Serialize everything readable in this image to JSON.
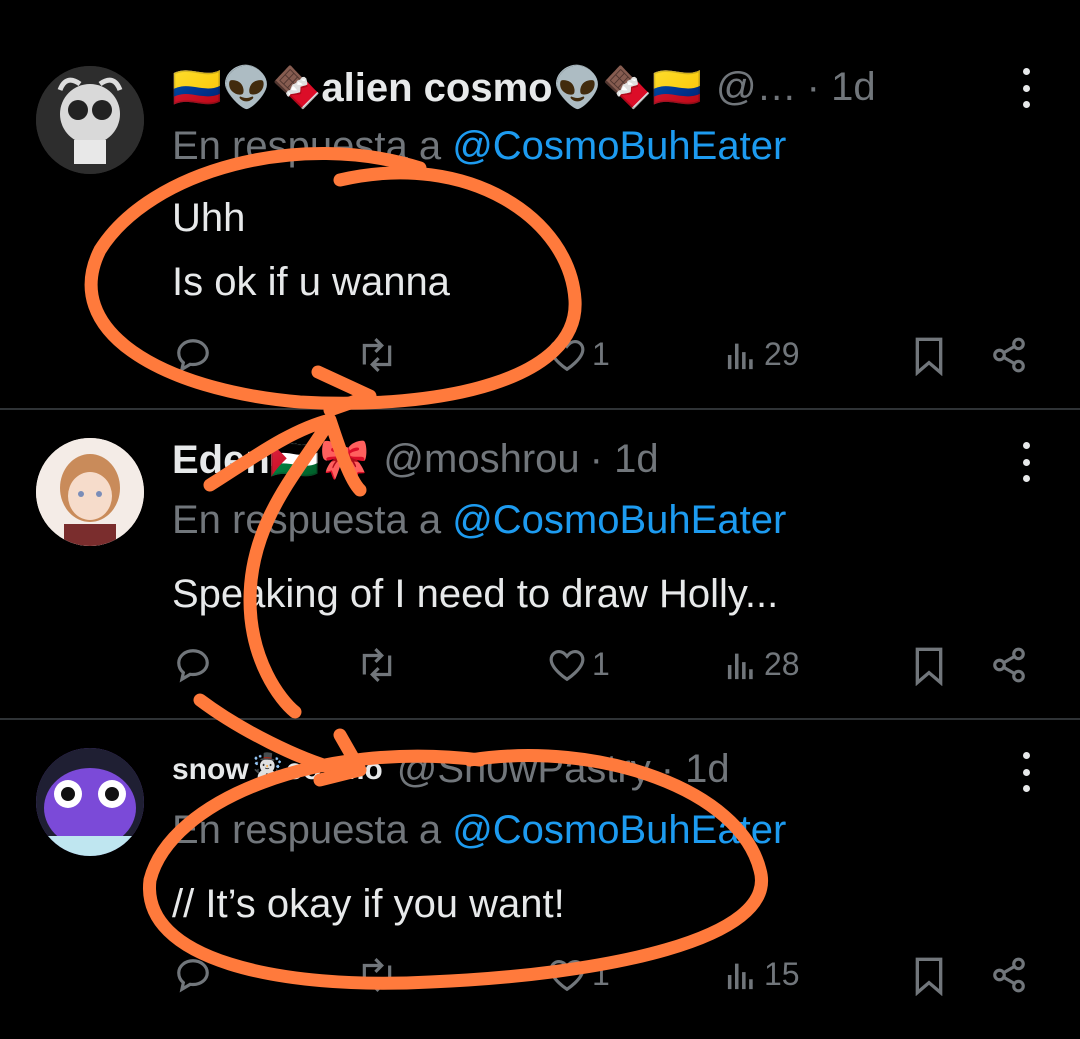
{
  "tweets": [
    {
      "name": "🇨🇴👽🍫alien cosmo👽🍫🇨🇴",
      "handle": "@…",
      "time": "· 1d",
      "reply_prefix": "En respuesta a",
      "reply_mention": "@CosmoBuhEater",
      "text": "Uhh\nIs ok if u wanna",
      "likes": "1",
      "views": "29",
      "avatar_color": "#3a3a3a"
    },
    {
      "name": "Eden🇵🇸🎀",
      "handle": "@moshrou",
      "time": "· 1d",
      "reply_prefix": "En respuesta a",
      "reply_mention": "@CosmoBuhEater",
      "text": "Speaking of I need to draw Holly...",
      "likes": "1",
      "views": "28",
      "avatar_color": "#f2e6df"
    },
    {
      "name": "snow☃️cosmo",
      "handle": "@Sn0wPastry",
      "time": "· 1d",
      "reply_prefix": "En respuesta a",
      "reply_mention": "@CosmoBuhEater",
      "text": "// It’s okay if you want!",
      "likes": "1",
      "views": "15",
      "avatar_color": "#7b4ad8"
    }
  ],
  "colors": {
    "background": "#000000",
    "text": "#e7e9ea",
    "muted": "#71767b",
    "mention": "#1d9bf0",
    "annotation": "#ff7a3c"
  },
  "icons": [
    "reply-icon",
    "retweet-icon",
    "like-icon",
    "views-icon",
    "bookmark-icon",
    "share-icon",
    "more-icon"
  ]
}
